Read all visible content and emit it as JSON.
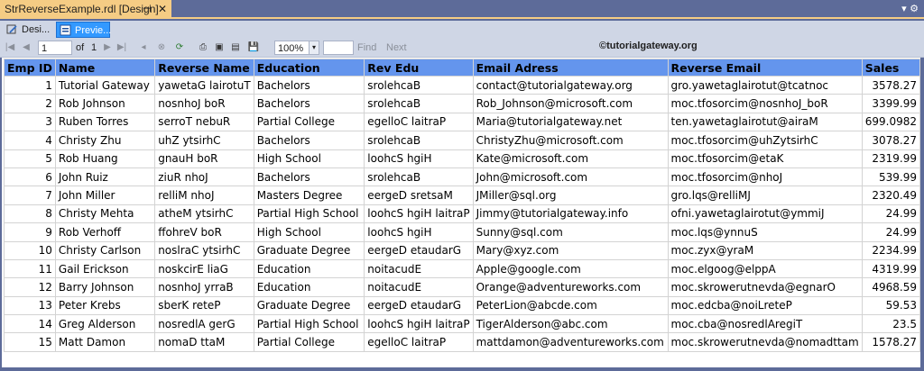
{
  "document_tab": {
    "title": "StrReverseExample.rdl [Design]",
    "pin_icon": "pin-icon",
    "close_glyph": "✕",
    "pin_glyph": "⊣"
  },
  "view_tabs": {
    "design_label": "Desi...",
    "preview_label": "Previe..."
  },
  "toolbar": {
    "page_value": "1",
    "of_label": "of",
    "page_count": "1",
    "zoom_value": "100%",
    "find_label": "Find",
    "next_label": "Next",
    "watermark": "©tutorialgateway.org"
  },
  "table": {
    "columns": [
      "Emp ID",
      "Name",
      "Reverse Name",
      "Education",
      "Rev Edu",
      "Email Adress",
      "Reverse Email",
      "Sales"
    ],
    "rows": [
      [
        "1",
        "Tutorial Gateway",
        "yawetaG lairotuT",
        "Bachelors",
        "srolehcaB",
        "contact@tutorialgateway.org",
        "gro.yawetaglairotut@tcatnoc",
        "3578.27"
      ],
      [
        "2",
        "Rob Johnson",
        "nosnhoJ boR",
        "Bachelors",
        "srolehcaB",
        "Rob_Johnson@microsoft.com",
        "moc.tfosorcim@nosnhoJ_boR",
        "3399.99"
      ],
      [
        "3",
        "Ruben Torres",
        "serroT nebuR",
        "Partial College",
        "egelloC laitraP",
        "Maria@tutorialgateway.net",
        "ten.yawetaglairotut@airaM",
        "699.0982"
      ],
      [
        "4",
        "Christy Zhu",
        "uhZ ytsirhC",
        "Bachelors",
        "srolehcaB",
        "ChristyZhu@microsoft.com",
        "moc.tfosorcim@uhZytsirhC",
        "3078.27"
      ],
      [
        "5",
        "Rob Huang",
        "gnauH boR",
        "High School",
        "loohcS hgiH",
        "Kate@microsoft.com",
        "moc.tfosorcim@etaK",
        "2319.99"
      ],
      [
        "6",
        "John Ruiz",
        "ziuR nhoJ",
        "Bachelors",
        "srolehcaB",
        "John@microsoft.com",
        "moc.tfosorcim@nhoJ",
        "539.99"
      ],
      [
        "7",
        "John Miller",
        "relliM nhoJ",
        "Masters Degree",
        "eergeD sretsaM",
        "JMiller@sql.org",
        "gro.lqs@relliMJ",
        "2320.49"
      ],
      [
        "8",
        "Christy Mehta",
        "atheM ytsirhC",
        "Partial High School",
        "loohcS hgiH laitraP",
        "Jimmy@tutorialgateway.info",
        "ofni.yawetaglairotut@ymmiJ",
        "24.99"
      ],
      [
        "9",
        "Rob Verhoff",
        "ffohreV boR",
        "High School",
        "loohcS hgiH",
        "Sunny@sql.com",
        "moc.lqs@ynnuS",
        "24.99"
      ],
      [
        "10",
        "Christy Carlson",
        "noslraC ytsirhC",
        "Graduate Degree",
        "eergeD etaudarG",
        "Mary@xyz.com",
        "moc.zyx@yraM",
        "2234.99"
      ],
      [
        "11",
        "Gail Erickson",
        "noskcirE liaG",
        "Education",
        "noitacudE",
        "Apple@google.com",
        "moc.elgoog@elppA",
        "4319.99"
      ],
      [
        "12",
        "Barry Johnson",
        "nosnhoJ yrraB",
        "Education",
        "noitacudE",
        "Orange@adventureworks.com",
        "moc.skrowerutnevda@egnarO",
        "4968.59"
      ],
      [
        "13",
        "Peter Krebs",
        "sberK reteP",
        "Graduate Degree",
        "eergeD etaudarG",
        "PeterLion@abcde.com",
        "moc.edcba@noiLreteP",
        "59.53"
      ],
      [
        "14",
        "Greg Alderson",
        "nosredlA gerG",
        "Partial High School",
        "loohcS hgiH laitraP",
        "TigerAlderson@abc.com",
        "moc.cba@nosredlAregiT",
        "23.5"
      ],
      [
        "15",
        "Matt Damon",
        "nomaD ttaM",
        "Partial College",
        "egelloC laitraP",
        "mattdamon@adventureworks.com",
        "moc.skrowerutnevda@nomadttam",
        "1578.27"
      ]
    ]
  },
  "colors": {
    "header_bg": "#6495ed",
    "tab_active": "#f5cc84",
    "preview_active": "#3399ff",
    "frame": "#5d6b99"
  }
}
